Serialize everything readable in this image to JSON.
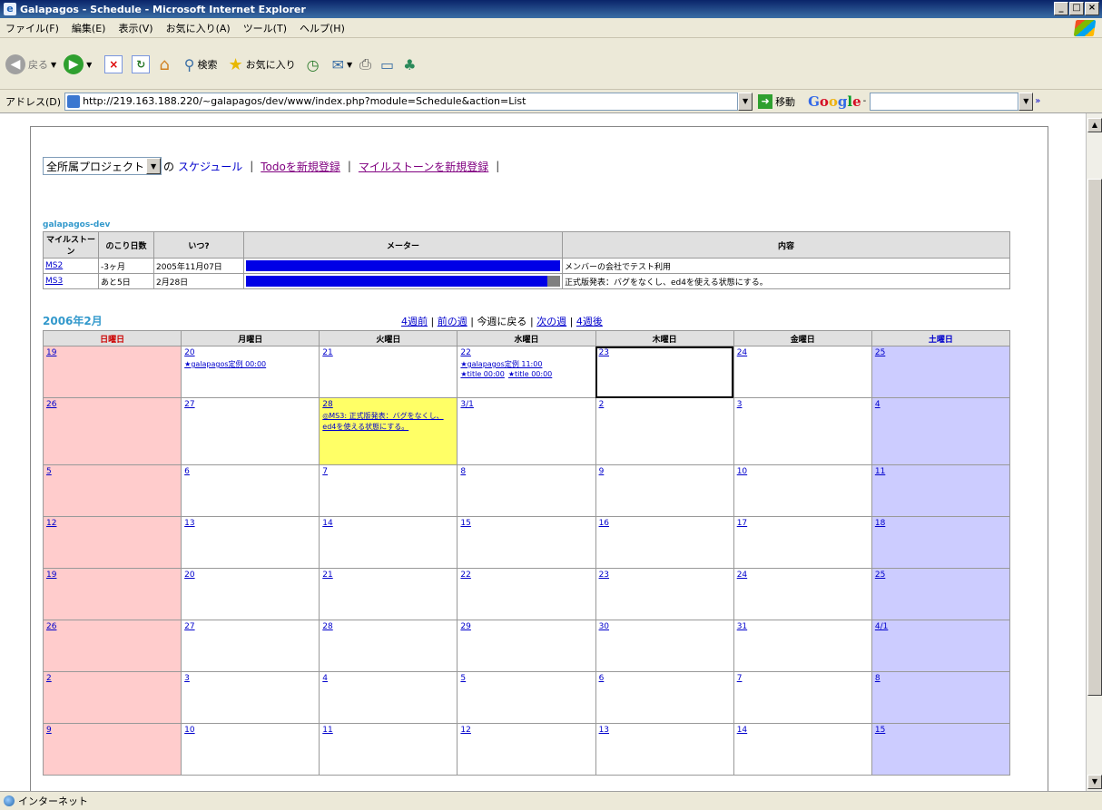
{
  "window": {
    "title": "Galapagos - Schedule - Microsoft Internet Explorer"
  },
  "menu": [
    "ファイル(F)",
    "編集(E)",
    "表示(V)",
    "お気に入り(A)",
    "ツール(T)",
    "ヘルプ(H)"
  ],
  "toolbar": {
    "back_label": "戻る",
    "search_label": "検索",
    "favorites_label": "お気に入り"
  },
  "address": {
    "label": "アドレス(D)",
    "url": "http://219.163.188.220/~galapagos/dev/www/index.php?module=Schedule&action=List",
    "go_label": "移動",
    "google": "Google -"
  },
  "status": {
    "zone": "インターネット"
  },
  "nav": {
    "project_select": "全所属プロジェクト",
    "of": "の",
    "schedule_link": "スケジュール",
    "todo_link": "Todoを新規登録",
    "milestone_link": "マイルストーンを新規登録"
  },
  "milestones": {
    "project": "galapagos-dev",
    "headers": [
      "マイルストーン",
      "のこり日数",
      "いつ?",
      "メーター",
      "内容"
    ],
    "rows": [
      {
        "name": "MS2",
        "remaining": "-3ヶ月",
        "when": "2005年11月07日",
        "progress": 1.0,
        "content": "メンバーの会社でテスト利用"
      },
      {
        "name": "MS3",
        "remaining": "あと5日",
        "when": "2月28日",
        "progress": 0.96,
        "content": "正式版発表：バグをなくし、ed4を使える状態にする。"
      }
    ]
  },
  "calendar": {
    "month": "2006年2月",
    "nav": {
      "prev4": "4週前",
      "prev": "前の週",
      "current": "今週に戻る",
      "next": "次の週",
      "next4": "4週後",
      "sep": "|"
    },
    "weekdays": [
      "日曜日",
      "月曜日",
      "火曜日",
      "水曜日",
      "木曜日",
      "金曜日",
      "土曜日"
    ],
    "weeks": [
      [
        {
          "d": "19"
        },
        {
          "d": "20",
          "ev": [
            "★galapagos定例 00:00"
          ]
        },
        {
          "d": "21"
        },
        {
          "d": "22",
          "ev": [
            "★galapagos定例 11:00"
          ],
          "ev2": [
            "★title 00:00",
            "★title 00:00"
          ]
        },
        {
          "d": "23",
          "today": true
        },
        {
          "d": "24"
        },
        {
          "d": "25"
        }
      ],
      [
        {
          "d": "26"
        },
        {
          "d": "27"
        },
        {
          "d": "28",
          "hl": true,
          "ev": [
            "◎MS3: 正式版発表：バグをなくし、ed4を使える状態にする。"
          ]
        },
        {
          "d": "3/1"
        },
        {
          "d": "2"
        },
        {
          "d": "3"
        },
        {
          "d": "4"
        }
      ],
      [
        {
          "d": "5"
        },
        {
          "d": "6"
        },
        {
          "d": "7"
        },
        {
          "d": "8"
        },
        {
          "d": "9"
        },
        {
          "d": "10"
        },
        {
          "d": "11"
        }
      ],
      [
        {
          "d": "12"
        },
        {
          "d": "13"
        },
        {
          "d": "14"
        },
        {
          "d": "15"
        },
        {
          "d": "16"
        },
        {
          "d": "17"
        },
        {
          "d": "18"
        }
      ],
      [
        {
          "d": "19"
        },
        {
          "d": "20"
        },
        {
          "d": "21"
        },
        {
          "d": "22"
        },
        {
          "d": "23"
        },
        {
          "d": "24"
        },
        {
          "d": "25"
        }
      ],
      [
        {
          "d": "26"
        },
        {
          "d": "27"
        },
        {
          "d": "28"
        },
        {
          "d": "29"
        },
        {
          "d": "30"
        },
        {
          "d": "31"
        },
        {
          "d": "4/1"
        }
      ],
      [
        {
          "d": "2"
        },
        {
          "d": "3"
        },
        {
          "d": "4"
        },
        {
          "d": "5"
        },
        {
          "d": "6"
        },
        {
          "d": "7"
        },
        {
          "d": "8"
        }
      ],
      [
        {
          "d": "9"
        },
        {
          "d": "10"
        },
        {
          "d": "11"
        },
        {
          "d": "12"
        },
        {
          "d": "13"
        },
        {
          "d": "14"
        },
        {
          "d": "15"
        }
      ]
    ]
  }
}
